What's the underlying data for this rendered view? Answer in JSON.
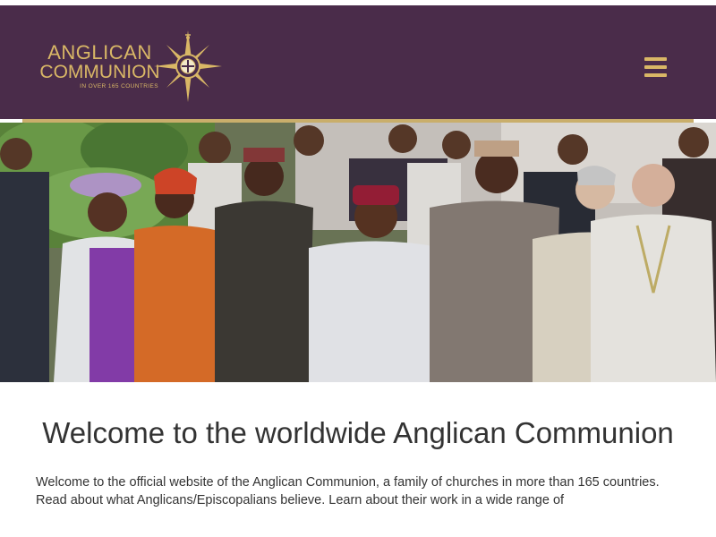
{
  "logo": {
    "line1": "ANGLICAN",
    "line2": "COMMUNION",
    "line3": "IN OVER 165 COUNTRIES",
    "icon": "compass-rose-icon"
  },
  "menu": {
    "icon": "hamburger-menu-icon"
  },
  "hero": {
    "icon": "group-photo-image"
  },
  "welcome": {
    "title": "Welcome to the worldwide Anglican Communion",
    "intro": "Welcome to the official website of the Anglican Communion, a family of churches in more than 165 countries. Read about what Anglicans/Episcopalians believe. Learn about their work in a wide range of"
  },
  "colors": {
    "header_bg": "#4a2c4a",
    "gold": "#d9b766",
    "rule": "#c9ae6b"
  }
}
